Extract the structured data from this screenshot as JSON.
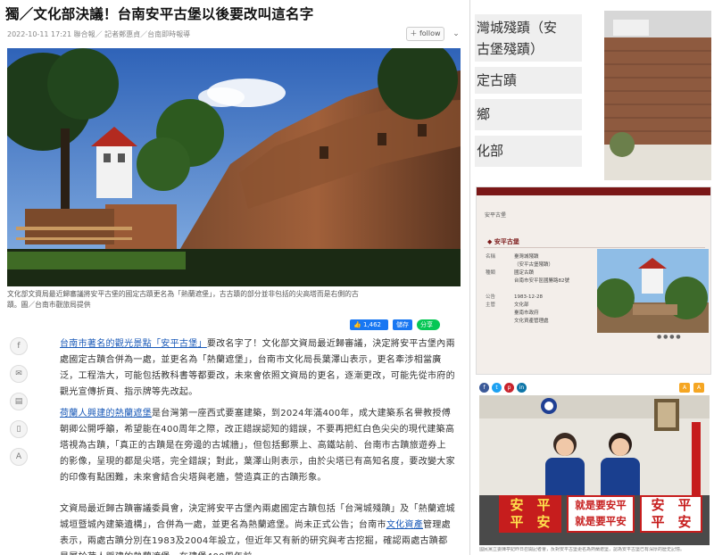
{
  "article": {
    "headline": "獨／文化部決議！台南安平古堡以後要改叫這名字",
    "meta": "2022-10-11 17:21  聯合報／ 記者鄭惠貞／台南即時報導",
    "follow_label": "＋ follow",
    "caption_line1": "文化部文資局最近歸審議將安平古堡的國定古蹟更名為「熱蘭遮堡」，古古蹟的部分並非包括的尖高塔而是右側的古",
    "caption_line2": "蹟。圖／台南市觀旅局提供",
    "share": {
      "like": "1,462",
      "save": "儲存",
      "line": "分享"
    },
    "side_icons": [
      "facebook-icon",
      "messenger-icon",
      "comment-icon",
      "bookmark-icon",
      "font-size-icon"
    ],
    "p1_link": "台南市著名的觀光景點「安平古堡」",
    "p1_text": "要改名字了！文化部文資局最近歸審議，決定將安平古堡內兩處國定古蹟合併為一處，並更名為「熱蘭遮堡」，台南市文化局長葉澤山表示，更名牽涉相當廣泛，工程浩大，可能包括教科書等都要改，未來會依照文資局的更名，逐漸更改，可能先從市府的觀光宣傳折頁、指示牌等先改起。",
    "p2_link": "荷蘭人興建的熱蘭遮堡",
    "p2_text": "是台灣第一座西式要塞建築，到2024年滿400年，成大建築系名譽教授傅朝卿公開呼籲，希望能在400周年之際，改正錯誤認知的錯誤，不要再把紅白色尖尖的現代建築高塔視為古蹟，「真正的古蹟是在旁邊的古城牆」，但包括郵票上、高鐵站前、台南市古蹟旅遊券上的影像，呈現的都是尖塔，完全錯誤；對此，葉澤山則表示，由於尖塔已有高知名度，要改變大家的印像有點困難，未來會結合尖塔與老牆，營造真正的古蹟形象。",
    "p3_text_a": "文資局最近歸古蹟審議委員會，決定將安平古堡內兩處國定古蹟包括「台灣城殘蹟」及「熱蘭遮城城垣暨城內建築遺構」，合併為一處，並更名為熱蘭遮堡。尚未正式公告；台南市",
    "p3_link": "文化資產",
    "p3_text_b": "管理處表示，兩處古蹟分別在1983及2004年設立，但近年又有新的研究與考古挖掘，確認兩處古蹟都是屬於荷人興建的熱蘭遮堡，在建堡400周年前"
  },
  "right_top": {
    "box1_line1": "灣城殘蹟（安",
    "box1_line2": "古堡殘蹟）",
    "box2": "定古蹟",
    "box3": "鄉",
    "box4": "化部"
  },
  "right_middle": {
    "breadcrumb": "安平古堡",
    "title": "安平古堡",
    "rows": [
      {
        "k": "名稱",
        "v": "臺灣城殘蹟"
      },
      {
        "k": "",
        "v": "（安平古堡殘蹟）"
      },
      {
        "k": "種類",
        "v": "國定古蹟"
      },
      {
        "k": "",
        "v": "台南市安平區國勝路82號"
      },
      {
        "k": "",
        "v": ""
      },
      {
        "k": "公告",
        "v": "1983-12-28"
      },
      {
        "k": "主管",
        "v": "文化部"
      },
      {
        "k": "",
        "v": "臺南市政府"
      },
      {
        "k": "",
        "v": "文化資產管理處"
      }
    ],
    "dots": "● ● ● ●"
  },
  "right_bottom": {
    "social": [
      "f",
      "t",
      "p",
      "in"
    ],
    "tools": [
      "A",
      "A"
    ],
    "sign1": [
      "安",
      "平",
      "平",
      "安"
    ],
    "sign2_line1": "就是要安平",
    "sign2_line2": "就是要平安",
    "sign3": [
      "安",
      "平",
      "平",
      "安"
    ],
    "caption": "國民黨立委陳亭妃昨日召開記者會，反對安平古堡更名為熱蘭遮堡，認為安平古堡已有深厚的歷史記憶。"
  }
}
